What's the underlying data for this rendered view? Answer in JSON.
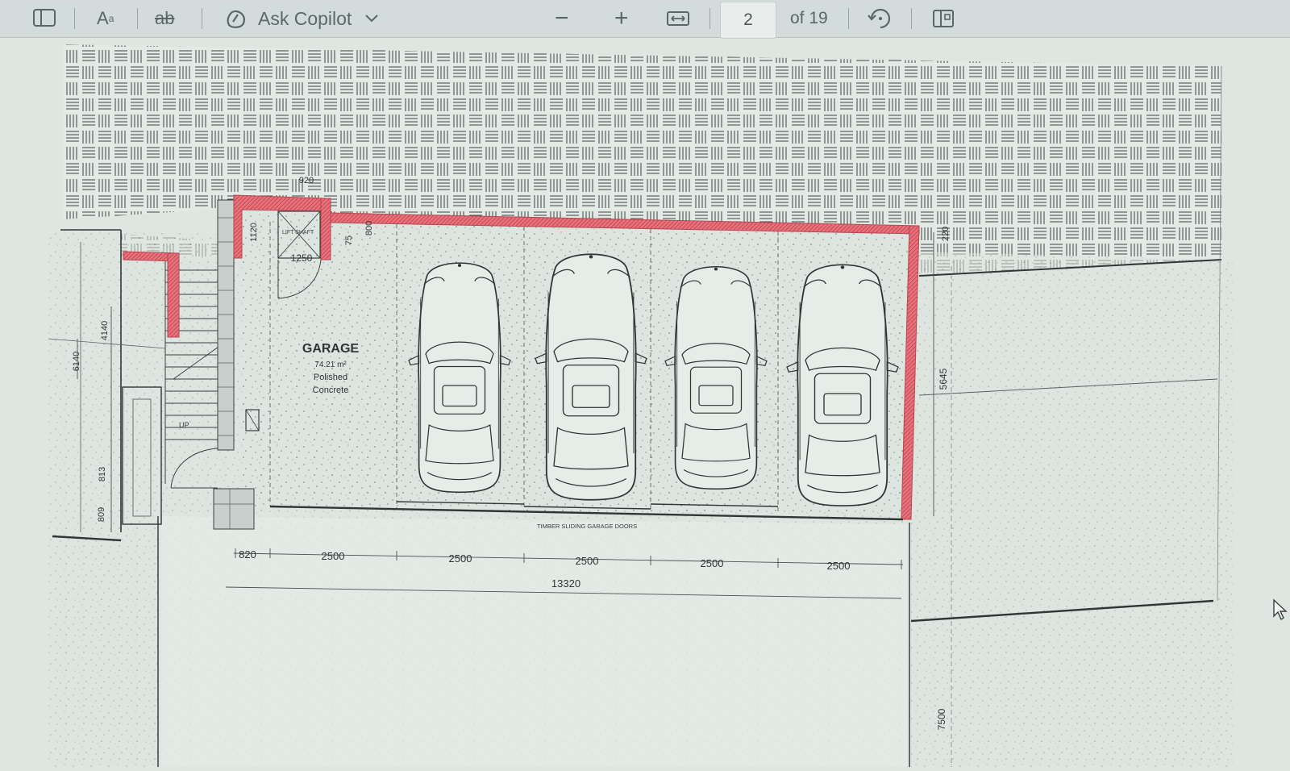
{
  "toolbar": {
    "font_size_label": "A",
    "font_size_superscript": "a",
    "spell_label": "ab",
    "ask_copilot_label": "Ask Copilot",
    "zoom_out_symbol": "−",
    "zoom_in_symbol": "+",
    "current_page": "2",
    "page_total_label": "of 19"
  },
  "plan": {
    "room_name": "GARAGE",
    "room_area": "74.21 m²",
    "floor_finish_line1": "Polished",
    "floor_finish_line2": "Concrete",
    "door_label": "TIMBER SLIDING GARAGE DOORS",
    "lift_label": "LIFT SHAFT",
    "stair_label": "UP",
    "dims": {
      "d920": "920",
      "d1120": "1120",
      "d1250": "1250",
      "d75": "75",
      "d800": "800",
      "d220": "220",
      "d4140": "4140",
      "d6140": "6140",
      "d813": "813",
      "d809": "809",
      "d5645": "5645",
      "d7500": "7500",
      "d820": "820",
      "bay1": "2500",
      "bay2": "2500",
      "bay3": "2500",
      "bay4": "2500",
      "bay5": "2500",
      "total": "13320"
    }
  },
  "colors": {
    "wall_red": "#e8717b",
    "paper": "#e4ebe6",
    "line": "#3a4040",
    "toolbar_bg": "#d3dcda"
  }
}
